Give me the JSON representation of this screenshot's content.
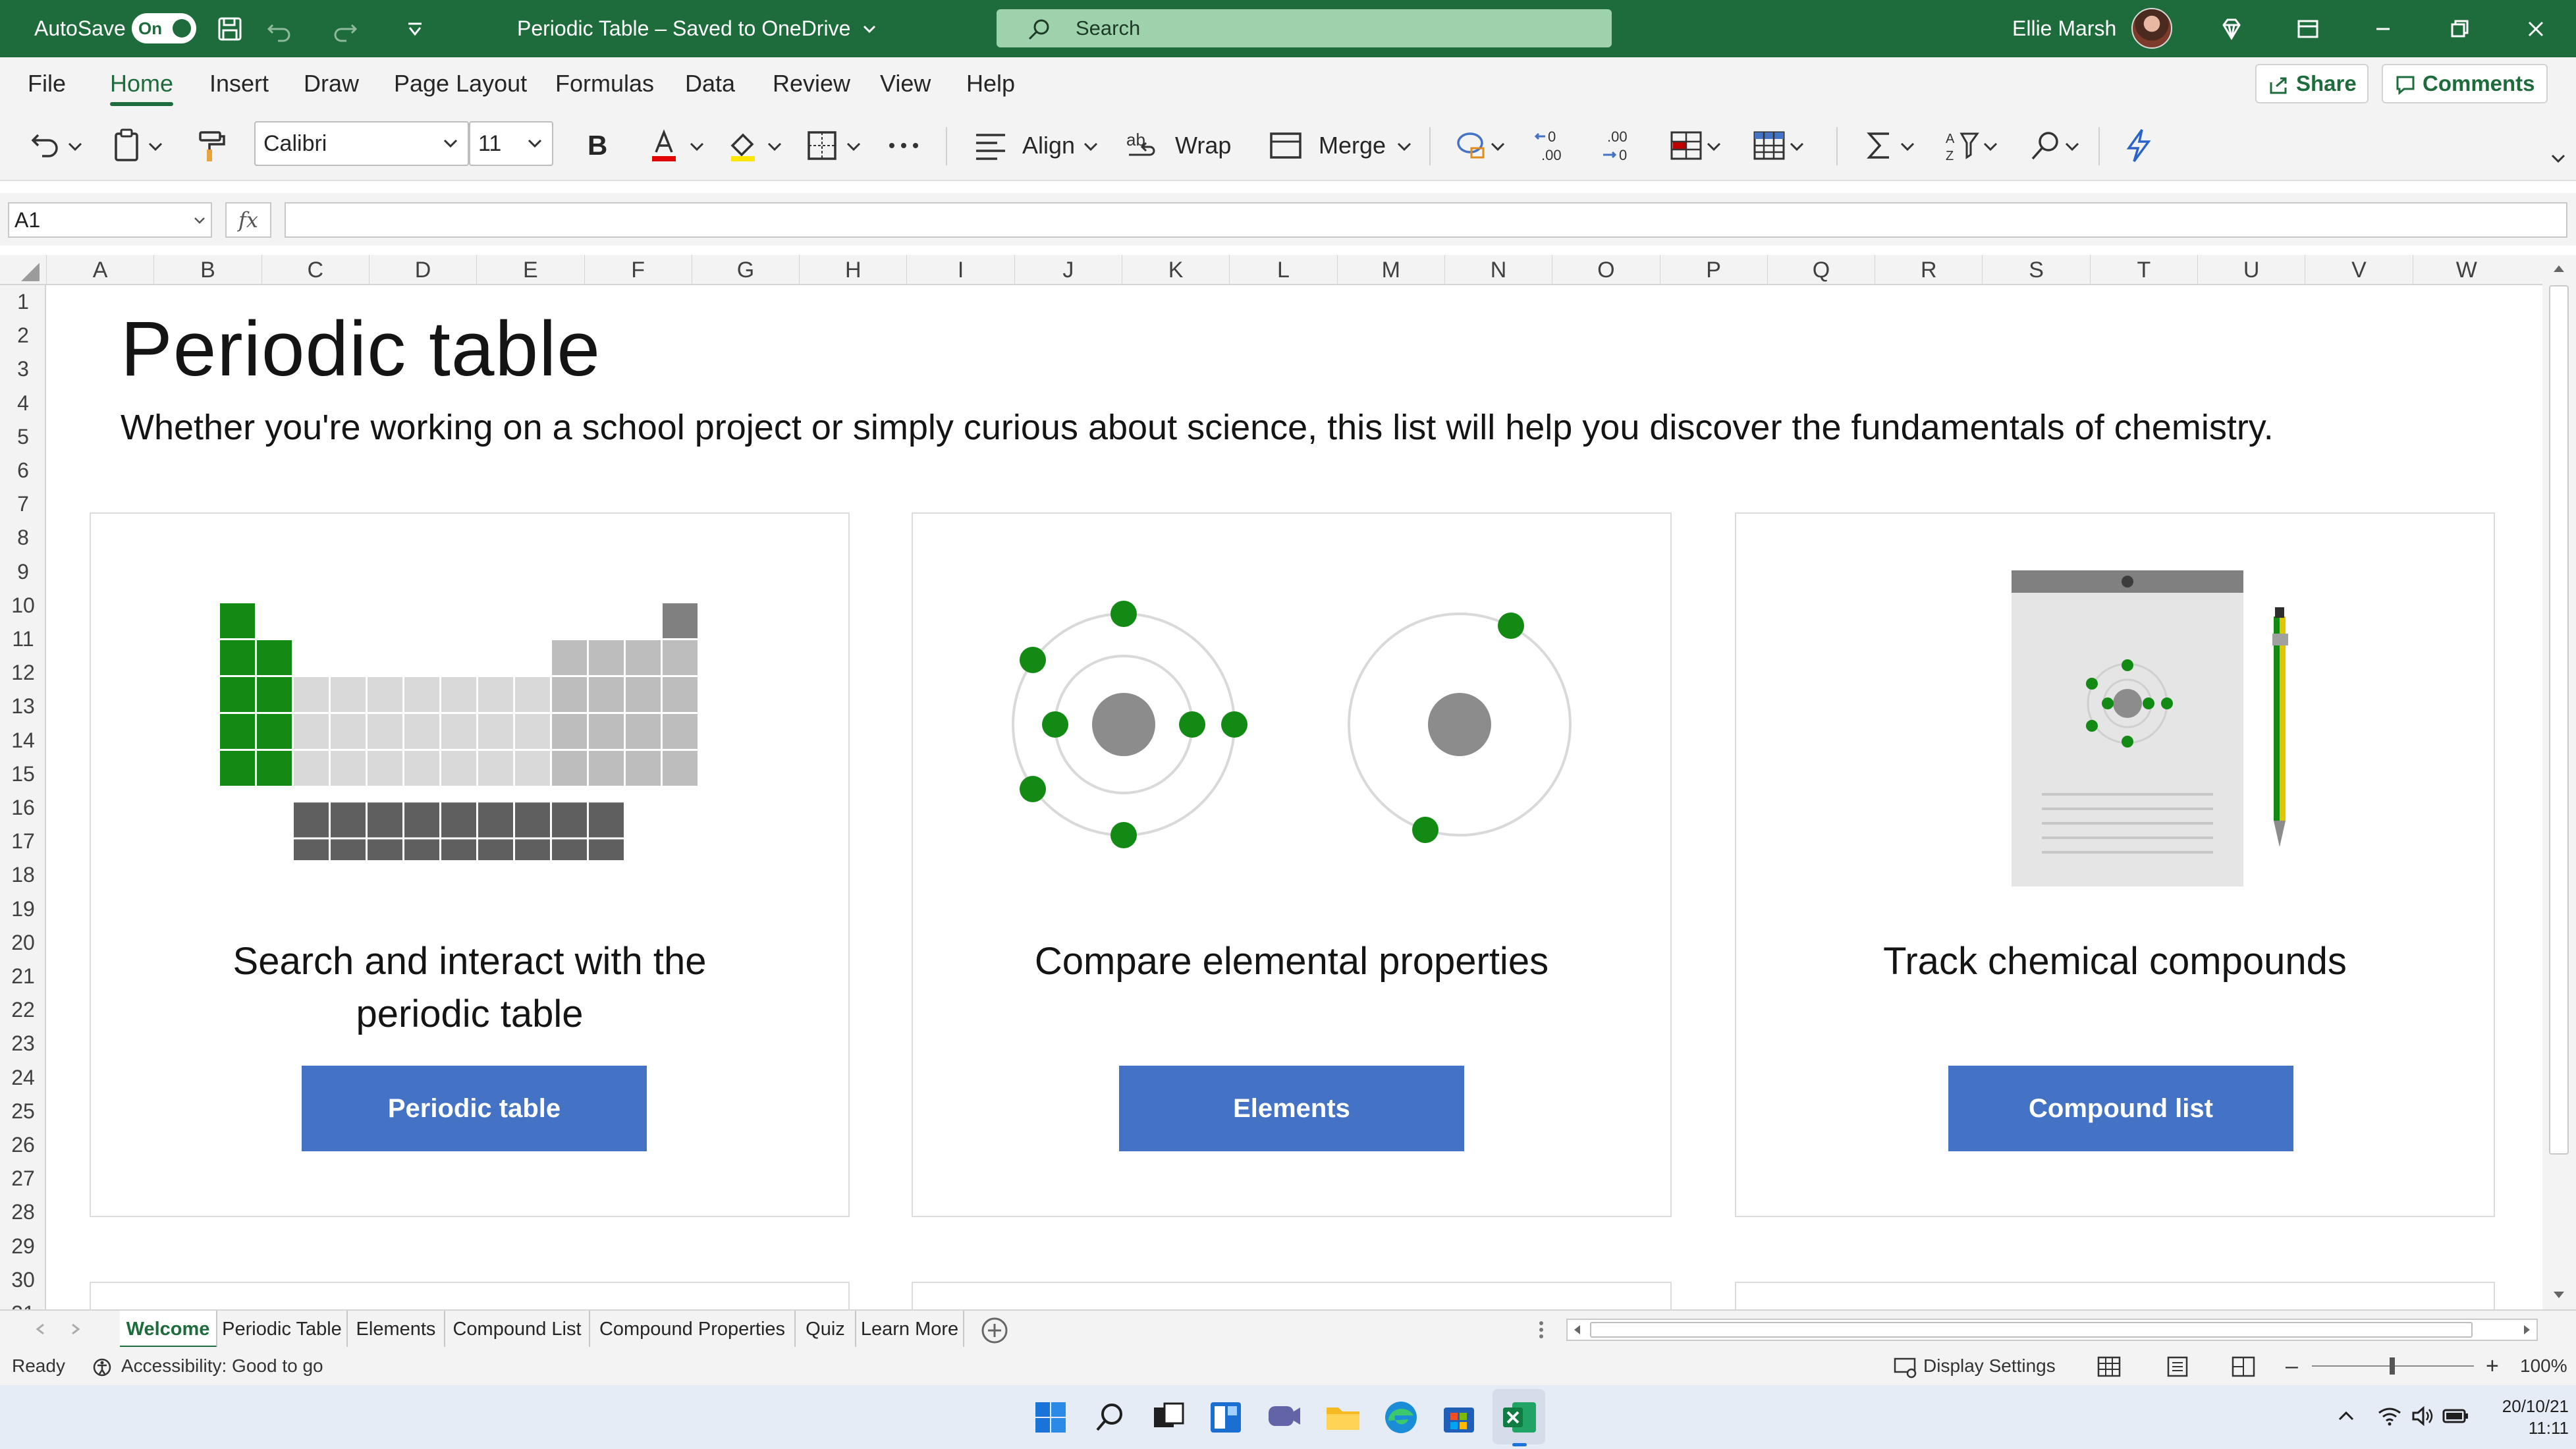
{
  "titlebar": {
    "autosave_label": "AutoSave",
    "autosave_state": "On",
    "document_title": "Periodic Table – Saved to OneDrive",
    "search_placeholder": "Search",
    "user_name": "Ellie Marsh"
  },
  "menu": {
    "tabs": [
      "File",
      "Home",
      "Insert",
      "Draw",
      "Page Layout",
      "Formulas",
      "Data",
      "Review",
      "View",
      "Help"
    ],
    "active": "Home",
    "share_label": "Share",
    "comments_label": "Comments"
  },
  "ribbon": {
    "font_name": "Calibri",
    "font_size": "11",
    "bold_label": "B",
    "align_label": "Align",
    "wrap_label": "Wrap",
    "merge_label": "Merge",
    "font_color": "#e00000",
    "highlight_color": "#ffe600"
  },
  "formula_bar": {
    "cell_ref": "A1",
    "fx_label": "fx",
    "value": ""
  },
  "grid": {
    "columns": [
      "A",
      "B",
      "C",
      "D",
      "E",
      "F",
      "G",
      "H",
      "I",
      "J",
      "K",
      "L",
      "M",
      "N",
      "O",
      "P",
      "Q",
      "R",
      "S",
      "T",
      "U",
      "V",
      "W"
    ],
    "rows": [
      "1",
      "2",
      "3",
      "4",
      "5",
      "6",
      "7",
      "8",
      "9",
      "10",
      "11",
      "12",
      "13",
      "14",
      "15",
      "16",
      "17",
      "18",
      "19",
      "20",
      "21",
      "22",
      "23",
      "24",
      "25",
      "26",
      "27",
      "28",
      "29",
      "30",
      "31"
    ]
  },
  "sheet": {
    "title": "Periodic table",
    "subtitle": "Whether you're working on a school project or simply curious about science, this list will help you discover the fundamentals of chemistry.",
    "cards": [
      {
        "title_line1": "Search and interact with the",
        "title_line2": "periodic table",
        "button": "Periodic table"
      },
      {
        "title_line1": "Compare elemental properties",
        "title_line2": "",
        "button": "Elements"
      },
      {
        "title_line1": "Track chemical compounds",
        "title_line2": "",
        "button": "Compound list"
      }
    ],
    "accent_green": "#138a13",
    "button_blue": "#4472c4"
  },
  "sheet_tabs": {
    "tabs": [
      "Welcome",
      "Periodic Table",
      "Elements",
      "Compound List",
      "Compound Properties",
      "Quiz",
      "Learn More"
    ],
    "active": "Welcome"
  },
  "statusbar": {
    "ready": "Ready",
    "accessibility": "Accessibility: Good to go",
    "display_settings": "Display Settings",
    "zoom": "100%"
  },
  "taskbar": {
    "date": "20/10/21",
    "time": "11:11"
  }
}
